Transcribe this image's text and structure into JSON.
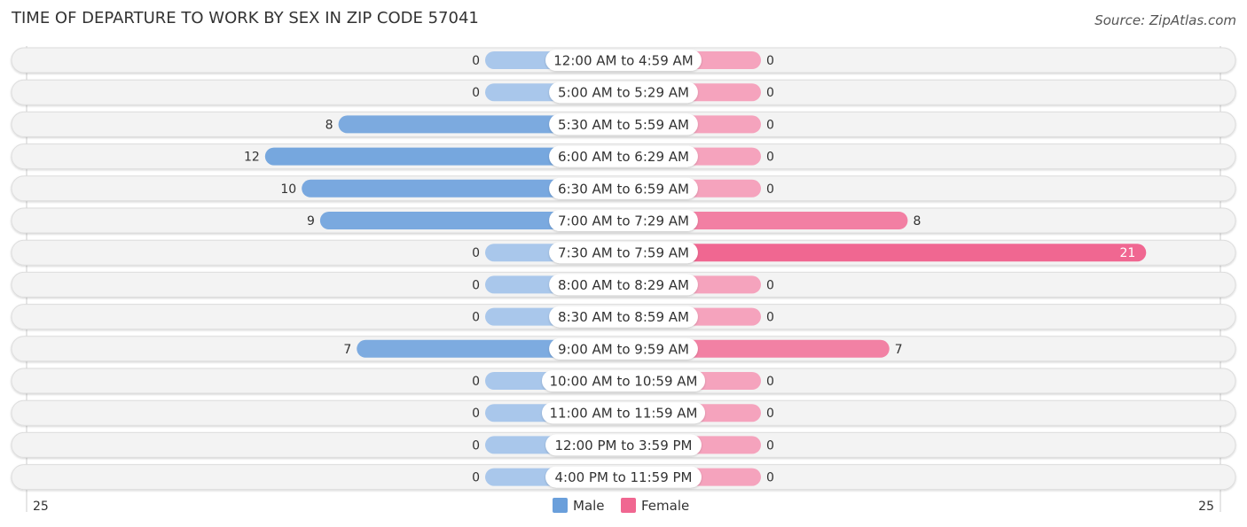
{
  "header": {
    "title": "TIME OF DEPARTURE TO WORK BY SEX IN ZIP CODE 57041",
    "source": "Source: ZipAtlas.com"
  },
  "colors": {
    "male": "#6a9fdb",
    "male_light": "#a9c7eb",
    "female": "#f06791",
    "female_light": "#f5a3bd",
    "row_bg": "#f3f3f3"
  },
  "chart_data": {
    "type": "bar",
    "orientation": "horizontal-diverging",
    "title": "TIME OF DEPARTURE TO WORK BY SEX IN ZIP CODE 57041",
    "categories": [
      "12:00 AM to 4:59 AM",
      "5:00 AM to 5:29 AM",
      "5:30 AM to 5:59 AM",
      "6:00 AM to 6:29 AM",
      "6:30 AM to 6:59 AM",
      "7:00 AM to 7:29 AM",
      "7:30 AM to 7:59 AM",
      "8:00 AM to 8:29 AM",
      "8:30 AM to 8:59 AM",
      "9:00 AM to 9:59 AM",
      "10:00 AM to 10:59 AM",
      "11:00 AM to 11:59 AM",
      "12:00 PM to 3:59 PM",
      "4:00 PM to 11:59 PM"
    ],
    "series": [
      {
        "name": "Male",
        "values": [
          0,
          0,
          8,
          12,
          10,
          9,
          0,
          0,
          0,
          7,
          0,
          0,
          0,
          0
        ]
      },
      {
        "name": "Female",
        "values": [
          0,
          0,
          0,
          0,
          0,
          8,
          21,
          0,
          0,
          7,
          0,
          0,
          0,
          0
        ]
      }
    ],
    "axis_min_label": "25",
    "axis_max_label": "25",
    "xlim": [
      -25,
      25
    ],
    "legend": {
      "position": "bottom-center",
      "entries": [
        "Male",
        "Female"
      ]
    },
    "grid": false
  }
}
